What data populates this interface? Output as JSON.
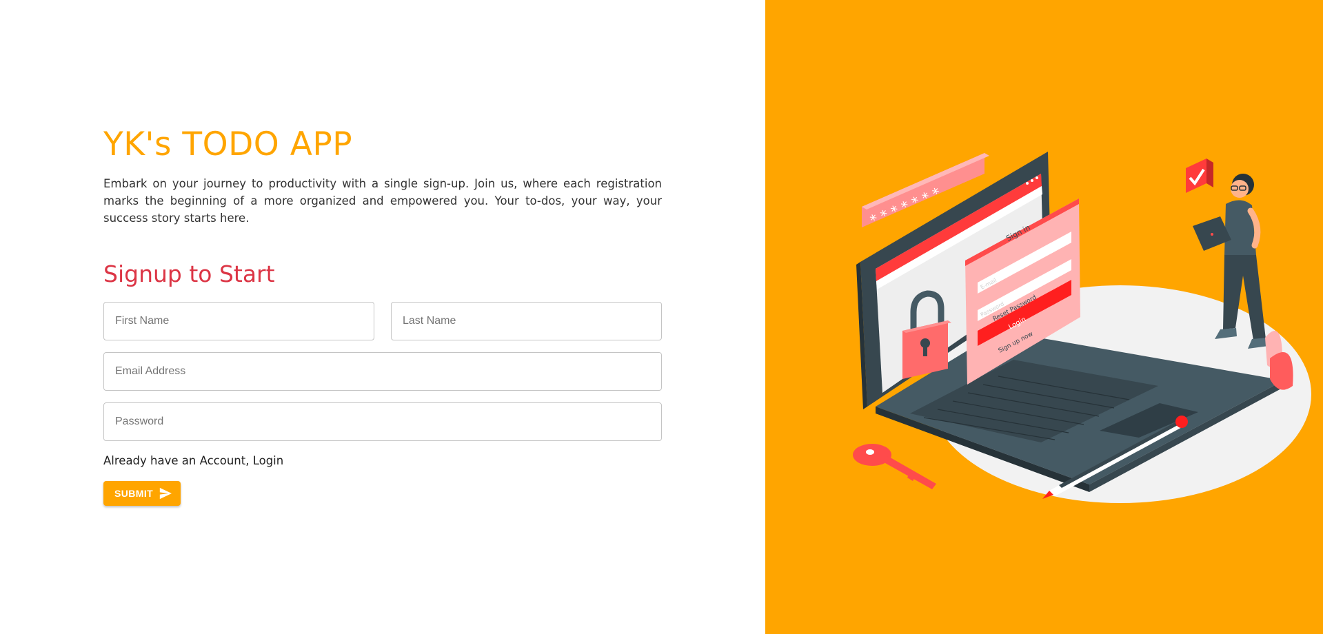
{
  "app": {
    "title": "YK's TODO APP",
    "description": "Embark on your journey to productivity with a single sign-up. Join us, where each registration marks the beginning of a more organized and empowered you. Your to-dos, your way, your success story starts here."
  },
  "form": {
    "heading": "Signup to Start",
    "first_name_placeholder": "First Name",
    "last_name_placeholder": "Last Name",
    "email_placeholder": "Email Address",
    "password_placeholder": "Password",
    "login_link": "Already have an Account, Login",
    "submit_label": "SUBMIT",
    "submit_icon": "send-icon"
  },
  "illustration": {
    "sign_in": "Sign in",
    "email": "E-mail",
    "password": "Password",
    "reset_password": "Reset Password",
    "login": "Login",
    "sign_up_now": "Sign up now",
    "password_dots": "* * * * * * *"
  },
  "colors": {
    "accent": "#ffa500",
    "heading_red": "#dc3545",
    "illustration_red": "#ff4b4b"
  }
}
